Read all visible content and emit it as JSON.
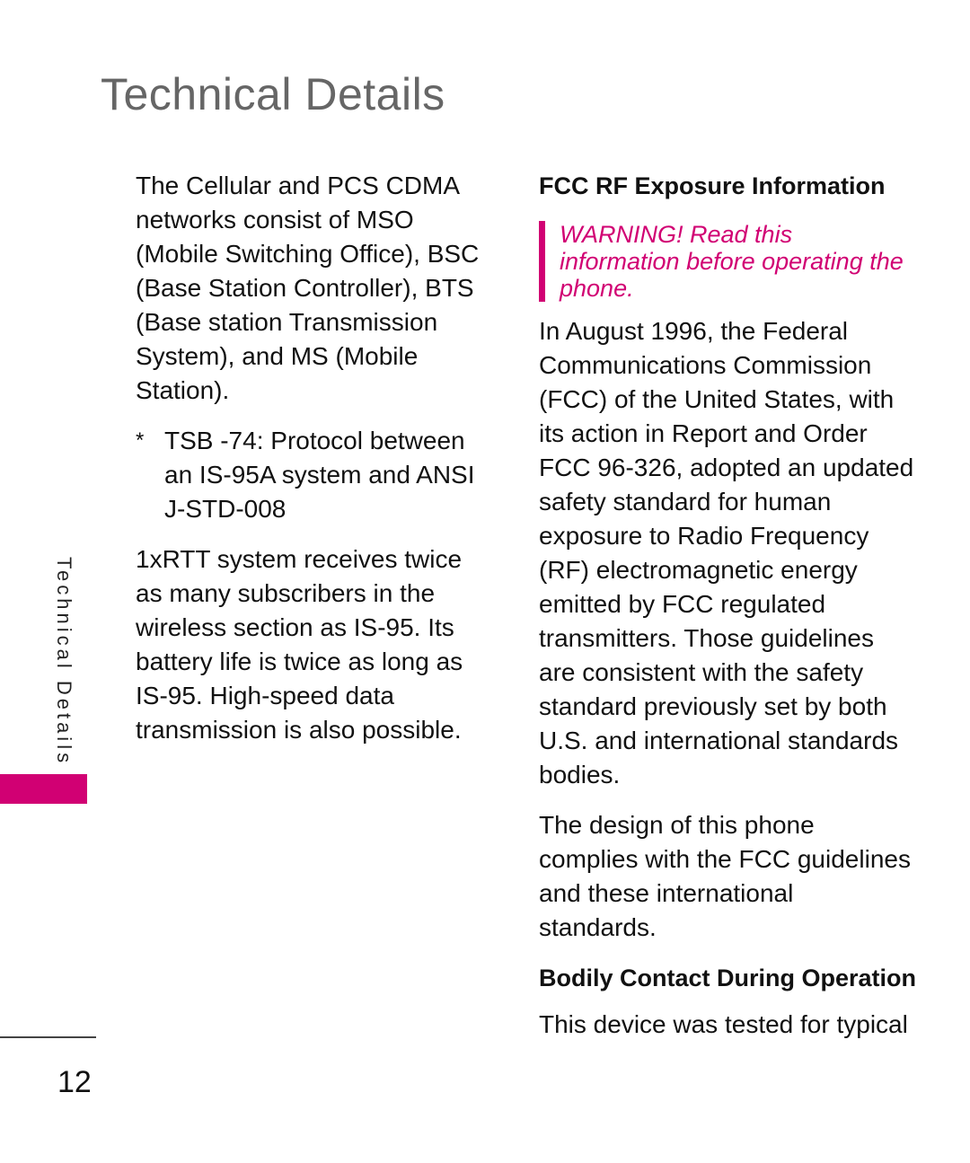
{
  "page": {
    "title": "Technical Details",
    "side_tab": "Technical Details",
    "page_number": "12",
    "accent_color": "#d10073"
  },
  "left_column": {
    "paragraph_1": "The Cellular and PCS CDMA networks consist of MSO (Mobile Switching Office), BSC (Base Station Controller), BTS (Base station Transmission System), and MS (Mobile Station).",
    "footnote_marker": "*",
    "footnote": "TSB -74: Protocol between an IS-95A system and ANSI J-STD-008",
    "paragraph_2": "1xRTT system receives twice as many subscribers in the wireless section as IS-95. Its battery life is twice as long as IS-95. High-speed data transmission is also possible."
  },
  "right_column": {
    "heading_1": "FCC RF Exposure Information",
    "warning": "WARNING! Read this information before operating the phone.",
    "paragraph_1": "In August 1996, the Federal Communications Commission (FCC) of the United States, with its action in Report and Order FCC 96-326, adopted an updated safety standard for human exposure to Radio Frequency (RF) electromagnetic energy emitted by FCC regulated transmitters. Those guidelines are consistent with the safety standard previously set by both U.S. and international standards bodies.",
    "paragraph_2": "The design of this phone complies with the FCC guidelines and these international standards.",
    "heading_2": "Bodily Contact During Operation",
    "paragraph_3": "This device was tested for typical"
  }
}
